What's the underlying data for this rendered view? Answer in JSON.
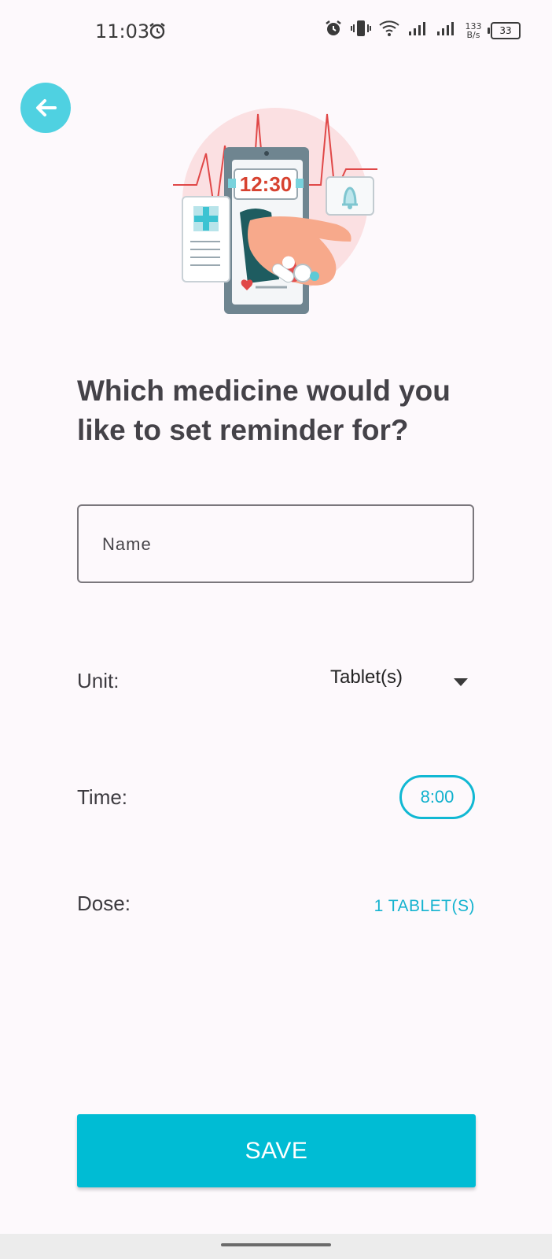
{
  "status_bar": {
    "time": "11:03",
    "net_speed_value": "133",
    "net_speed_unit": "B/s",
    "battery": "33"
  },
  "question": "Which medicine would you like to set reminder for?",
  "illustration": {
    "clock_text": "12:30"
  },
  "name_field": {
    "placeholder": "Name",
    "value": ""
  },
  "unit": {
    "label": "Unit:",
    "value": "Tablet(s)"
  },
  "time": {
    "label": "Time:",
    "value": "8:00"
  },
  "dose": {
    "label": "Dose:",
    "value": "1 TABLET(S)"
  },
  "save_label": "SAVE",
  "colors": {
    "accent": "#00bcd4",
    "back_button": "#4fd1e1",
    "background": "#fdf9fc"
  }
}
